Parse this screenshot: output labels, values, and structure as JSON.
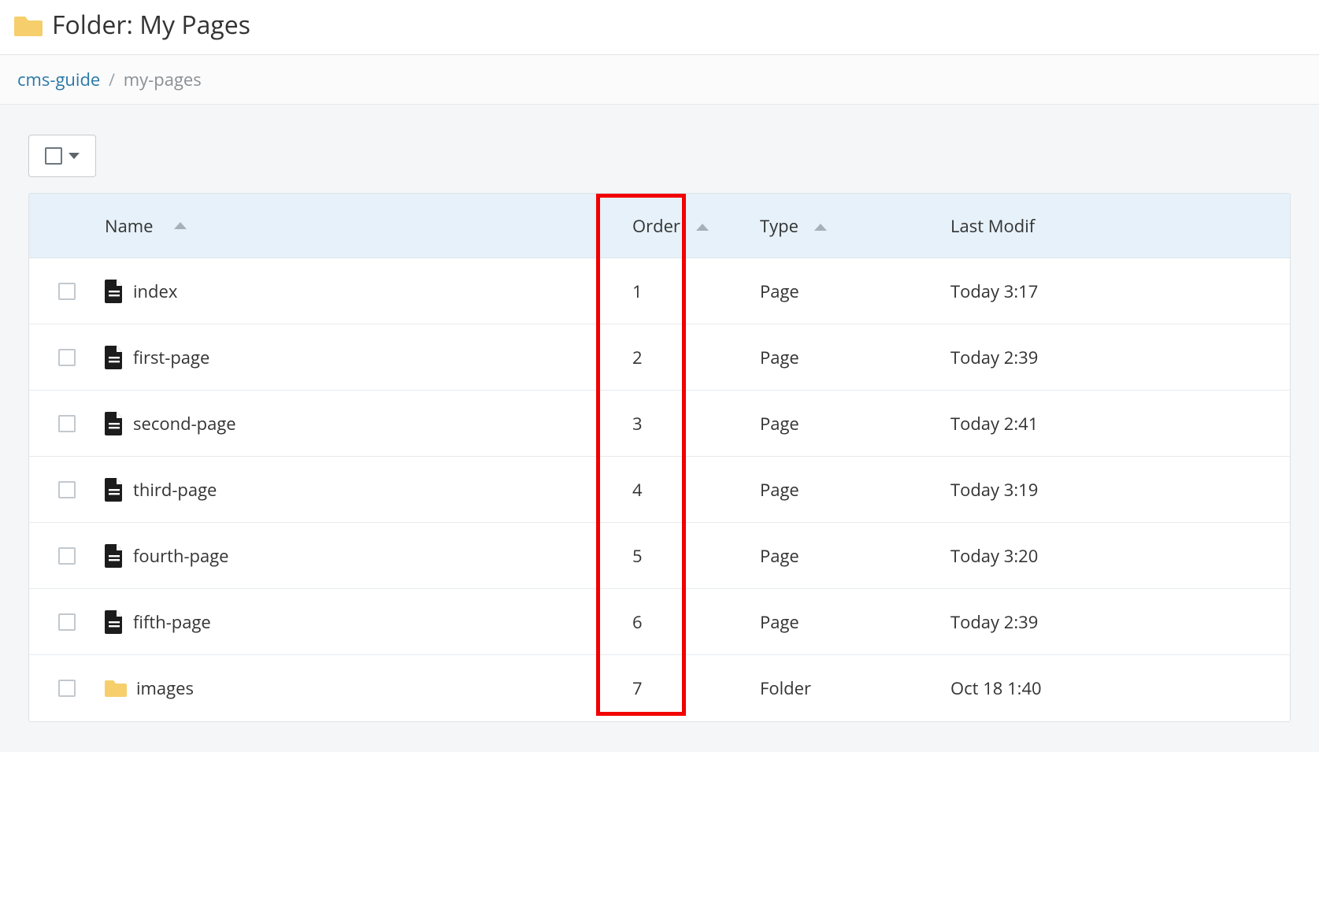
{
  "header": {
    "title": "Folder: My Pages"
  },
  "breadcrumb": {
    "root": "cms-guide",
    "separator": "/",
    "current": "my-pages"
  },
  "columns": {
    "name": "Name",
    "order": "Order",
    "type": "Type",
    "modified": "Last Modif"
  },
  "rows": [
    {
      "name": "index",
      "order": "1",
      "type": "Page",
      "modified": "Today 3:17",
      "icon": "page"
    },
    {
      "name": "first-page",
      "order": "2",
      "type": "Page",
      "modified": "Today 2:39",
      "icon": "page"
    },
    {
      "name": "second-page",
      "order": "3",
      "type": "Page",
      "modified": "Today 2:41",
      "icon": "page"
    },
    {
      "name": "third-page",
      "order": "4",
      "type": "Page",
      "modified": "Today 3:19",
      "icon": "page"
    },
    {
      "name": "fourth-page",
      "order": "5",
      "type": "Page",
      "modified": "Today 3:20",
      "icon": "page"
    },
    {
      "name": "fifth-page",
      "order": "6",
      "type": "Page",
      "modified": "Today 2:39",
      "icon": "page"
    },
    {
      "name": "images",
      "order": "7",
      "type": "Folder",
      "modified": "Oct 18 1:40",
      "icon": "folder"
    }
  ]
}
